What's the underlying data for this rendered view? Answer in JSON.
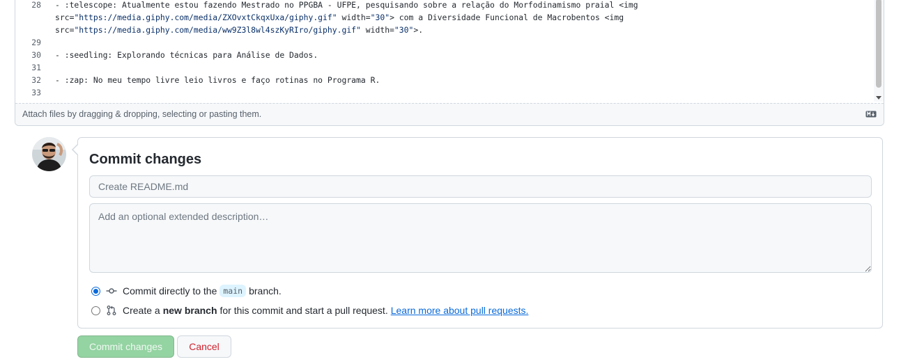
{
  "editor": {
    "lines": [
      {
        "num": "28",
        "segments": [
          {
            "t": "- :telescope: Atualmente estou fazendo Mestrado no PPGBA - UFPE, pesquisando sobre a relação do Morfodinamismo praial <img",
            "c": ""
          }
        ]
      },
      {
        "num": "",
        "segments": [
          {
            "t": "src=",
            "c": ""
          },
          {
            "t": "\"https://media.giphy.com/media/ZXOvxtCkqxUxa/giphy.gif\"",
            "c": "str"
          },
          {
            "t": " width=",
            "c": ""
          },
          {
            "t": "\"30\"",
            "c": "str"
          },
          {
            "t": "> com a Diversidade Funcional de Macrobentos <img",
            "c": ""
          }
        ]
      },
      {
        "num": "",
        "segments": [
          {
            "t": "src=",
            "c": ""
          },
          {
            "t": "\"https://media.giphy.com/media/ww9Z3l8wl4szKyRIro/giphy.gif\"",
            "c": "str"
          },
          {
            "t": " width=",
            "c": ""
          },
          {
            "t": "\"30\"",
            "c": "str"
          },
          {
            "t": ">.",
            "c": ""
          }
        ]
      },
      {
        "num": "29",
        "segments": []
      },
      {
        "num": "30",
        "segments": [
          {
            "t": "- :seedling: Explorando técnicas para Análise de Dados.",
            "c": ""
          }
        ]
      },
      {
        "num": "31",
        "segments": []
      },
      {
        "num": "32",
        "segments": [
          {
            "t": "- :zap: No meu tempo livre leio livros e faço rotinas no Programa R.",
            "c": ""
          }
        ]
      },
      {
        "num": "33",
        "segments": []
      }
    ],
    "attach_hint": "Attach files by dragging & dropping, selecting or pasting them.",
    "markdown_icon": "markdown-icon"
  },
  "commit": {
    "title": "Commit changes",
    "summary_placeholder": "Create README.md",
    "description_placeholder": "Add an optional extended description…",
    "options": [
      {
        "checked": true,
        "icon": "git-commit-icon",
        "before": "Commit directly to the",
        "branch": "main",
        "after": "branch."
      },
      {
        "checked": false,
        "icon": "git-pull-request-icon",
        "before": "Create a",
        "bold": "new branch",
        "after": "for this commit and start a pull request.",
        "link": "Learn more about pull requests."
      }
    ],
    "submit_label": "Commit changes",
    "cancel_label": "Cancel"
  },
  "colors": {
    "accent": "#0969da",
    "commit_button_disabled": "#94d3a2",
    "cancel_text": "#cf222e",
    "branch_pill": "#ddf4ff"
  }
}
